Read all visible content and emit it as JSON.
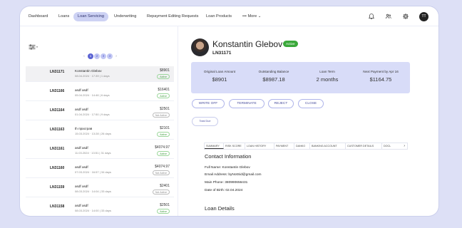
{
  "nav": {
    "items": [
      "Dashboard",
      "Loans",
      "Loan Servicing",
      "Underwriting",
      "Repayment Editing Requests",
      "Loan Products",
      "More"
    ],
    "more_prefix": "•••",
    "avatar_initials": "TT",
    "icons": [
      "bell-icon",
      "people-icon",
      "gear-icon"
    ]
  },
  "pager": {
    "prev": "‹",
    "pages": [
      "1",
      "2",
      "3",
      "4"
    ],
    "next": "›"
  },
  "loans": [
    {
      "id": "LN31171",
      "name": "Konstantin Glebov",
      "date": "08.04.2024 · 17:39 | 1 days",
      "amount": "$8901",
      "status": "Active"
    },
    {
      "id": "LN31166",
      "name": "asdf asdf",
      "date": "05.04.2024 · 14:46 | 6 days",
      "amount": "$16401",
      "status": "Active"
    },
    {
      "id": "LN31164",
      "name": "asdf asdf",
      "date": "01.04.2024 · 17:50 | 9 days",
      "amount": "$2501",
      "status": "Not Active"
    },
    {
      "id": "LN31163",
      "name": "th прасграв",
      "date": "15.03.2024 · 13:28 | 26 days",
      "amount": "$2101",
      "status": "Active"
    },
    {
      "id": "LN31161",
      "name": "asdf asdf",
      "date": "11.03.2024 · 13:51 | 31 days",
      "amount": "$4074.97",
      "status": "Active"
    },
    {
      "id": "LN31160",
      "name": "asdf asdf",
      "date": "07.03.2024 · 16:57 | 34 days",
      "amount": "$4074.97",
      "status": "Not Active"
    },
    {
      "id": "LN31159",
      "name": "asdf asdf",
      "date": "08.03.2024 · 14:04 | 33 days",
      "amount": "$2401",
      "status": "Not Active"
    },
    {
      "id": "LN31158",
      "name": "asdf asdf",
      "date": "08.03.2024 · 14:00 | 33 days",
      "amount": "$2501",
      "status": "Active"
    }
  ],
  "client": {
    "name": "Konstantin Glebov",
    "status": "Active",
    "loan_number": "LN31171"
  },
  "stats": [
    {
      "label": "Original Loan Amount",
      "value": "$8901"
    },
    {
      "label": "Outstanding Balance",
      "value": "$8987.18"
    },
    {
      "label": "Loan Term",
      "value": "2 months"
    },
    {
      "label": "Next Payment by Apr 16",
      "value": "$1164.75"
    }
  ],
  "actions": [
    "WRITE OFF",
    "TERMINATE",
    "REJECT",
    "CLOSE"
  ],
  "total_due_label": "Total Due",
  "tabs": [
    "SUMMARY",
    "RISK SCORE",
    "LOAN HISTORY",
    "PAYMENT",
    "DANKO",
    "BANKING ACCOUNT",
    "CUSTOMER DETAILS",
    "DOCL"
  ],
  "tabs_more": "›",
  "contact": {
    "title": "Contact Information",
    "full_name": "Full Name: Konstantin Glebov",
    "email": "Email Address: byNotSid@gmail.com",
    "phone": "Main Phone: 380990656431",
    "dob": "Date of Birth: 02.04.2024"
  },
  "loan_details_title": "Loan Details",
  "colors": {
    "accent": "#aeb4ea",
    "active_green": "#3aa83a",
    "stats_bg": "#d8dcf8",
    "page_bg": "#dde0f6"
  }
}
